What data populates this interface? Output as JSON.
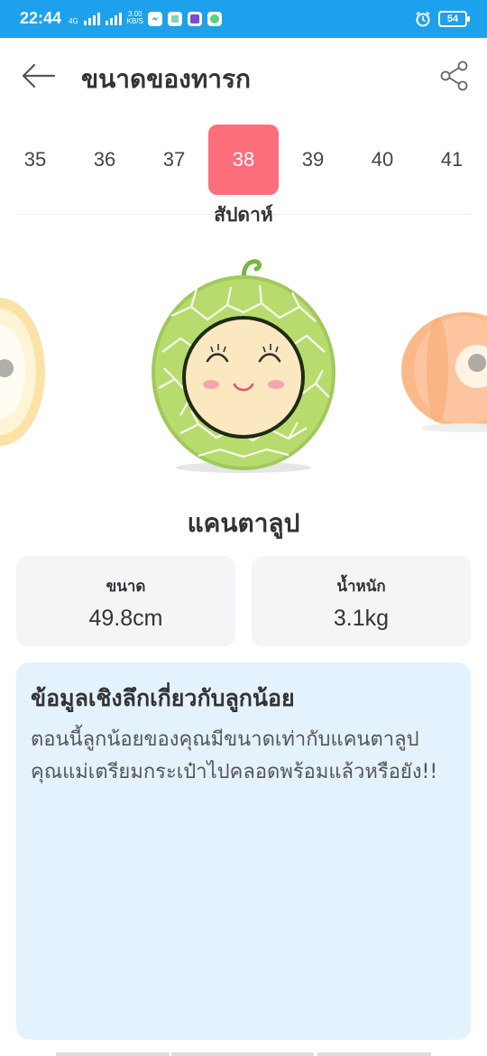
{
  "status_bar": {
    "time": "22:44",
    "network_type": "4G",
    "speed_value": "3.00",
    "speed_unit": "KB/S",
    "battery": "54"
  },
  "header": {
    "title": "ขนาดของทารก"
  },
  "weeks": {
    "items": [
      "35",
      "36",
      "37",
      "38",
      "39",
      "40",
      "41"
    ],
    "selected": "38",
    "unit_label": "สัปดาห์"
  },
  "fruit": {
    "name": "แคนตาลูป"
  },
  "stats": {
    "size_label": "ขนาด",
    "size_value": "49.8cm",
    "weight_label": "น้ำหนัก",
    "weight_value": "3.1kg"
  },
  "info": {
    "title": "ข้อมูลเชิงลึกเกี่ยวกับลูกน้อย",
    "body": "ตอนนี้ลูกน้อยของคุณมีขนาดเท่ากับแคนตาลูป คุณแม่เตรียมกระเป๋าไปคลอดพร้อมแล้วหรือยัง!!"
  },
  "colors": {
    "status_bar": "#1da1ec",
    "accent": "#fd6e7c",
    "info_card": "#e4f2fe",
    "stat_card": "#f5f5f7"
  },
  "icons": {
    "back": "arrow-left-icon",
    "share": "share-icon",
    "alarm": "alarm-icon"
  }
}
